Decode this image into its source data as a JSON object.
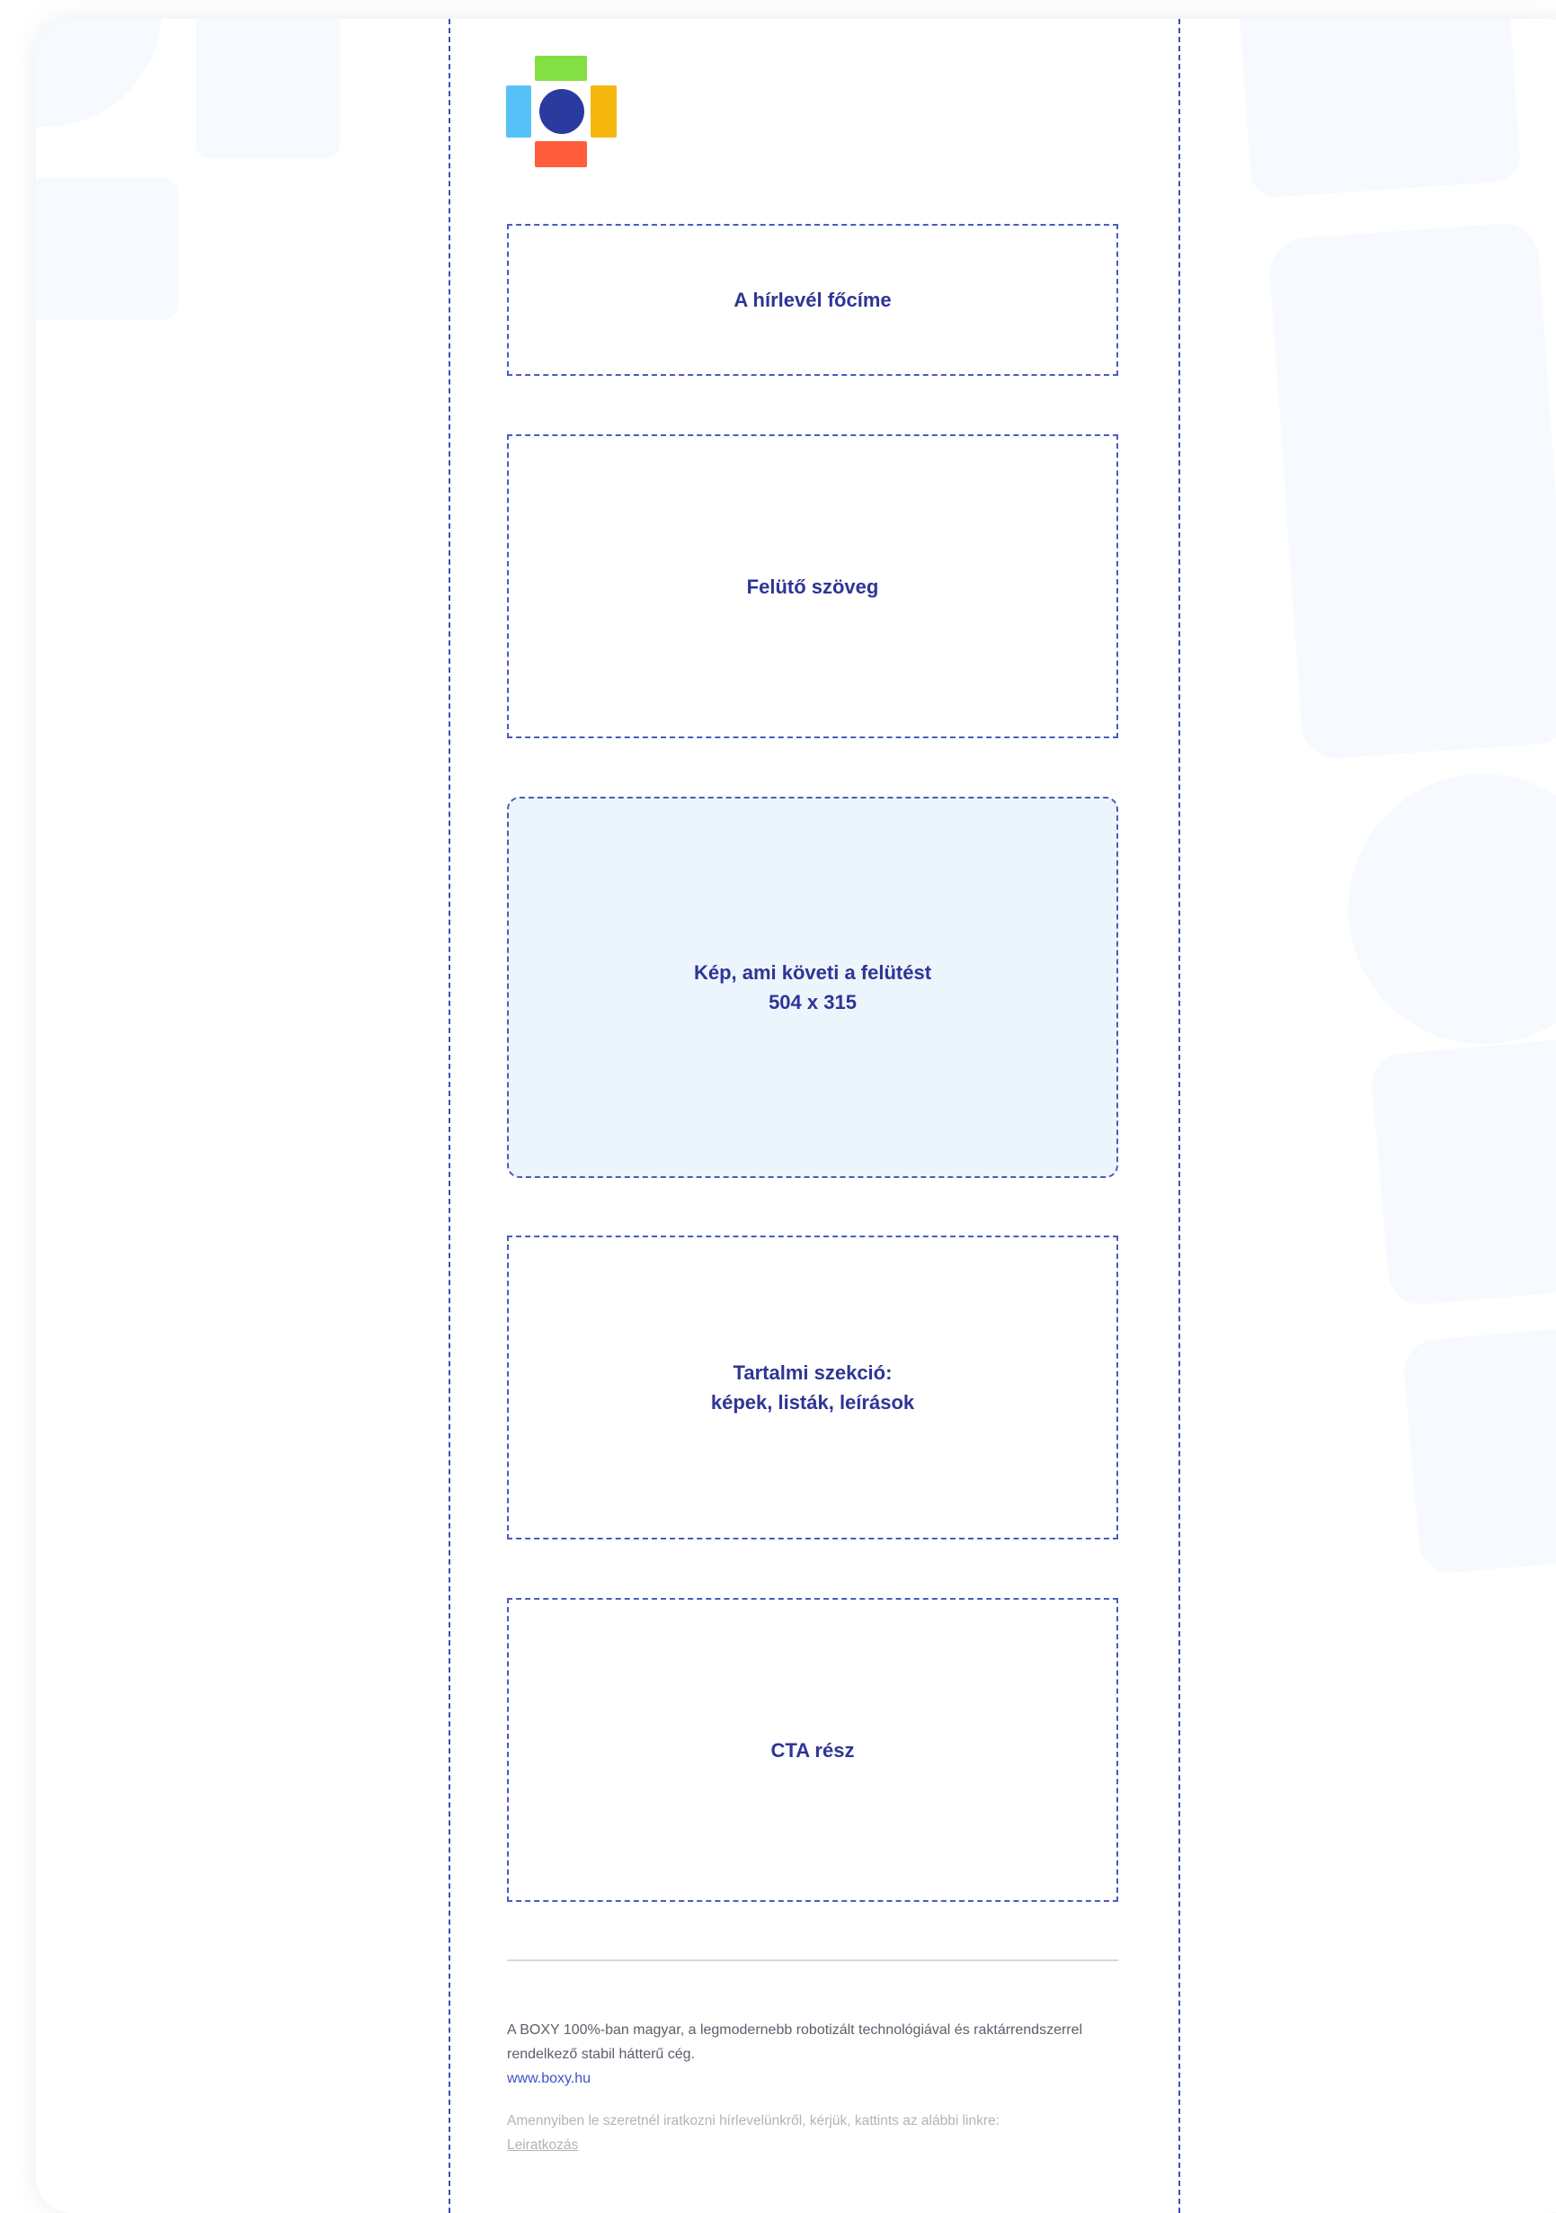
{
  "newsletter": {
    "logo_colors": {
      "top": "#83df44",
      "left": "#57c2f7",
      "right": "#f6b70e",
      "bottom": "#ff5d3b",
      "center": "#2b3a9f"
    },
    "accent_color": "#2d3596",
    "sections": {
      "headline": "A hírlevél főcíme",
      "lead_text": "Felütő szöveg",
      "image": "Kép, ami követi a felütést\n504 x 315",
      "content": "Tartalmi szekció:\nképek, listák, leírások",
      "cta": "CTA rész"
    },
    "footer": {
      "about": "A BOXY 100%-ban magyar, a legmodernebb robotizált technológiával és raktárrendszerrel rendelkező stabil hátterű cég.",
      "website": "www.boxy.hu",
      "unsubscribe_text": "Amennyiben le szeretnél iratkozni hírlevelünkről, kérjük, kattints az alábbi linkre:",
      "unsubscribe_link": "Leiratkozás"
    }
  }
}
